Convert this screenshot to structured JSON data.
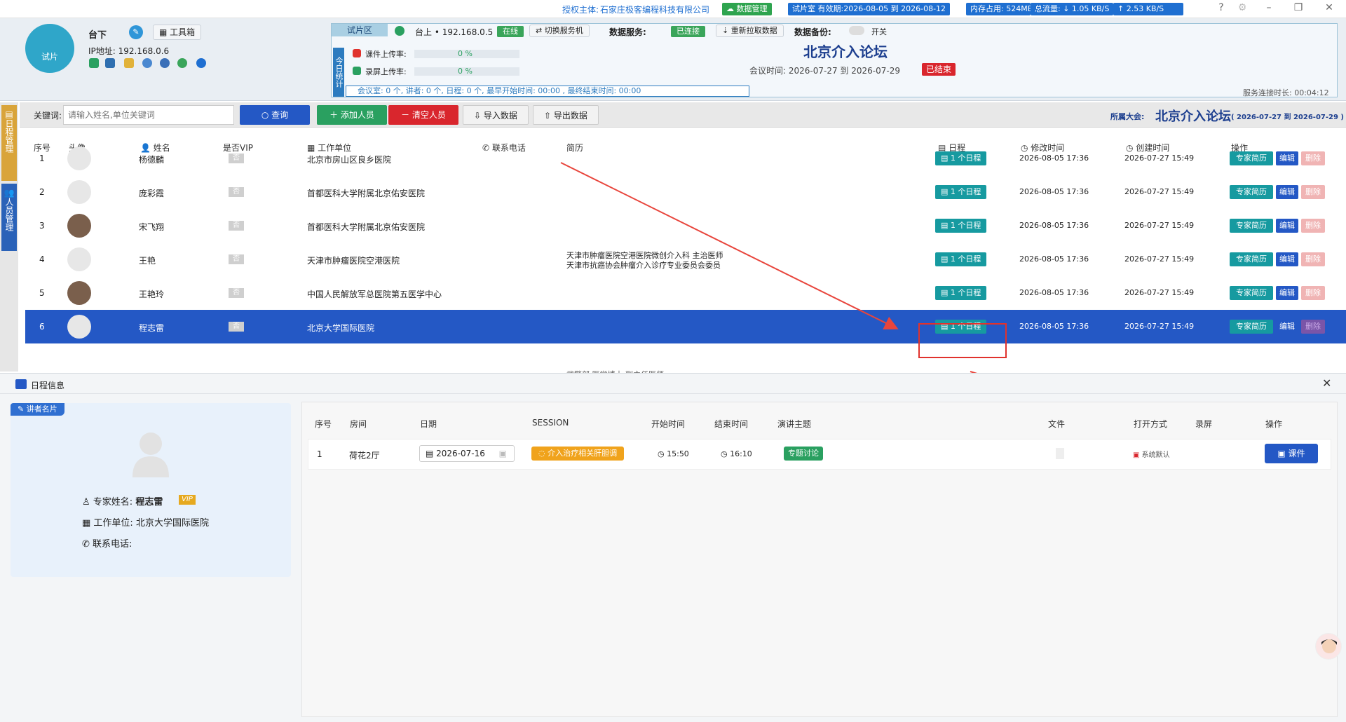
{
  "titlebar": {
    "license_label": "授权主体:",
    "license_company": "石家庄极客编程科技有限公司",
    "data_mgmt": "数据管理",
    "trial_validity": "试片室 有效期:2026-08-05 到 2026-08-12",
    "memory": "内存占用: 524MB",
    "traffic_down": "总流量: ↓ 1.05 KB/S",
    "traffic_up": "↑ 2.53 KB/S",
    "colors": {
      "blue": "#1f6fd1",
      "green": "#2ea44f"
    }
  },
  "header": {
    "avatar_label": "试片",
    "location": "台下",
    "toolbox_label": "工具箱",
    "ip_label": "IP地址: 192.168.0.6",
    "trial_tab": "试片区",
    "stage_host": "台上 • 192.168.0.5",
    "online": "在线",
    "switch_server": "切换服务机",
    "data_service_label": "数据服务:",
    "data_service_status": "已连接",
    "refetch": "重新拉取数据",
    "backup_label": "数据备份:",
    "backup_switch": "开关",
    "stats_side": "今日统计",
    "upload_course": "课件上传率:",
    "upload_course_pct": "0 %",
    "upload_record": "录屏上传率:",
    "upload_record_pct": "0 %",
    "stats_line": "会议室: 0 个,  讲者: 0 个,  日程: 0 个,  最早开始时间: 00:00 ,   最终结束时间: 00:00",
    "conference_title": "北京介入论坛",
    "meeting_time": "会议时间: 2026-07-27  到  2026-07-29",
    "ended": "已结束",
    "service_uptime": "服务连接时长: 00:04:12"
  },
  "sidebar": {
    "tab1": "日程管理",
    "tab2": "人员管理"
  },
  "toolbar": {
    "keyword_label": "关键词:",
    "search_placeholder": "请输入姓名,单位关键词",
    "search_btn": "查询",
    "add_btn": "添加人员",
    "clear_btn": "清空人员",
    "import_btn": "导入数据",
    "export_btn": "导出数据",
    "conference_label": "所属大会:",
    "conference_name": "北京介入论坛",
    "conference_dates": "( 2026-07-27 到 2026-07-29 )"
  },
  "table": {
    "headers": [
      "序号",
      "头像",
      "姓名",
      "是否VIP",
      "工作单位",
      "联系电话",
      "简历",
      "日程",
      "修改时间",
      "创建时间",
      "操作"
    ],
    "rows": [
      {
        "no": "1",
        "name": "杨德麟",
        "vip": "否",
        "unit": "北京市房山区良乡医院",
        "resume1": "",
        "resume2": "",
        "sched": "1 个日程",
        "mod": "2026-08-05  17:36",
        "created": "2026-07-27  15:49"
      },
      {
        "no": "2",
        "name": "庞彩霞",
        "vip": "否",
        "unit": "首都医科大学附属北京佑安医院",
        "resume1": "",
        "resume2": "",
        "sched": "1 个日程",
        "mod": "2026-08-05  17:36",
        "created": "2026-07-27  15:49"
      },
      {
        "no": "3",
        "name": "宋飞翔",
        "vip": "否",
        "unit": "首都医科大学附属北京佑安医院",
        "resume1": "",
        "resume2": "",
        "sched": "1 个日程",
        "mod": "2026-08-05  17:36",
        "created": "2026-07-27  15:49"
      },
      {
        "no": "4",
        "name": "王艳",
        "vip": "否",
        "unit": "天津市肿瘤医院空港医院",
        "resume1": "天津市肿瘤医院空港医院微创介入科 主治医师",
        "resume2": "天津市抗癌协会肿瘤介入诊疗专业委员会委员",
        "sched": "1 个日程",
        "mod": "2026-08-05  17:36",
        "created": "2026-07-27  15:49"
      },
      {
        "no": "5",
        "name": "王艳玲",
        "vip": "否",
        "unit": "中国人民解放军总医院第五医学中心",
        "resume1": "",
        "resume2": "",
        "sched": "1 个日程",
        "mod": "2026-08-05  17:36",
        "created": "2026-07-27  15:49"
      },
      {
        "no": "6",
        "name": "程志雷",
        "vip": "否",
        "unit": "北京大学国际医院",
        "resume1": "",
        "resume2": "",
        "sched": "1 个日程",
        "mod": "2026-08-05  17:36",
        "created": "2026-07-27  15:49"
      }
    ],
    "actions": {
      "resume": "专家简历",
      "edit": "编辑",
      "delete": "删除"
    },
    "partial_row_text": "武警部 医学博士  副主任医师"
  },
  "panel": {
    "title": "日程信息",
    "card_tag": "讲者名片",
    "expert_label": "专家姓名:",
    "expert_name": "程志雷",
    "vip_badge": "VIP",
    "unit_label": "工作单位:",
    "unit_value": "北京大学国际医院",
    "phone_label": "联系电话:",
    "phone_value": "",
    "headers": [
      "序号",
      "房间",
      "日期",
      "SESSION",
      "开始时间",
      "结束时间",
      "演讲主题",
      "文件",
      "打开方式",
      "录屏",
      "操作"
    ],
    "row": {
      "no": "1",
      "room": "荷花2厅",
      "date": "2026-07-16",
      "session": "介入治疗相关肝胆调",
      "start": "15:50",
      "end": "16:10",
      "topic": "专题讨论",
      "open_mode": "系统默认",
      "course_btn": "课件"
    }
  }
}
